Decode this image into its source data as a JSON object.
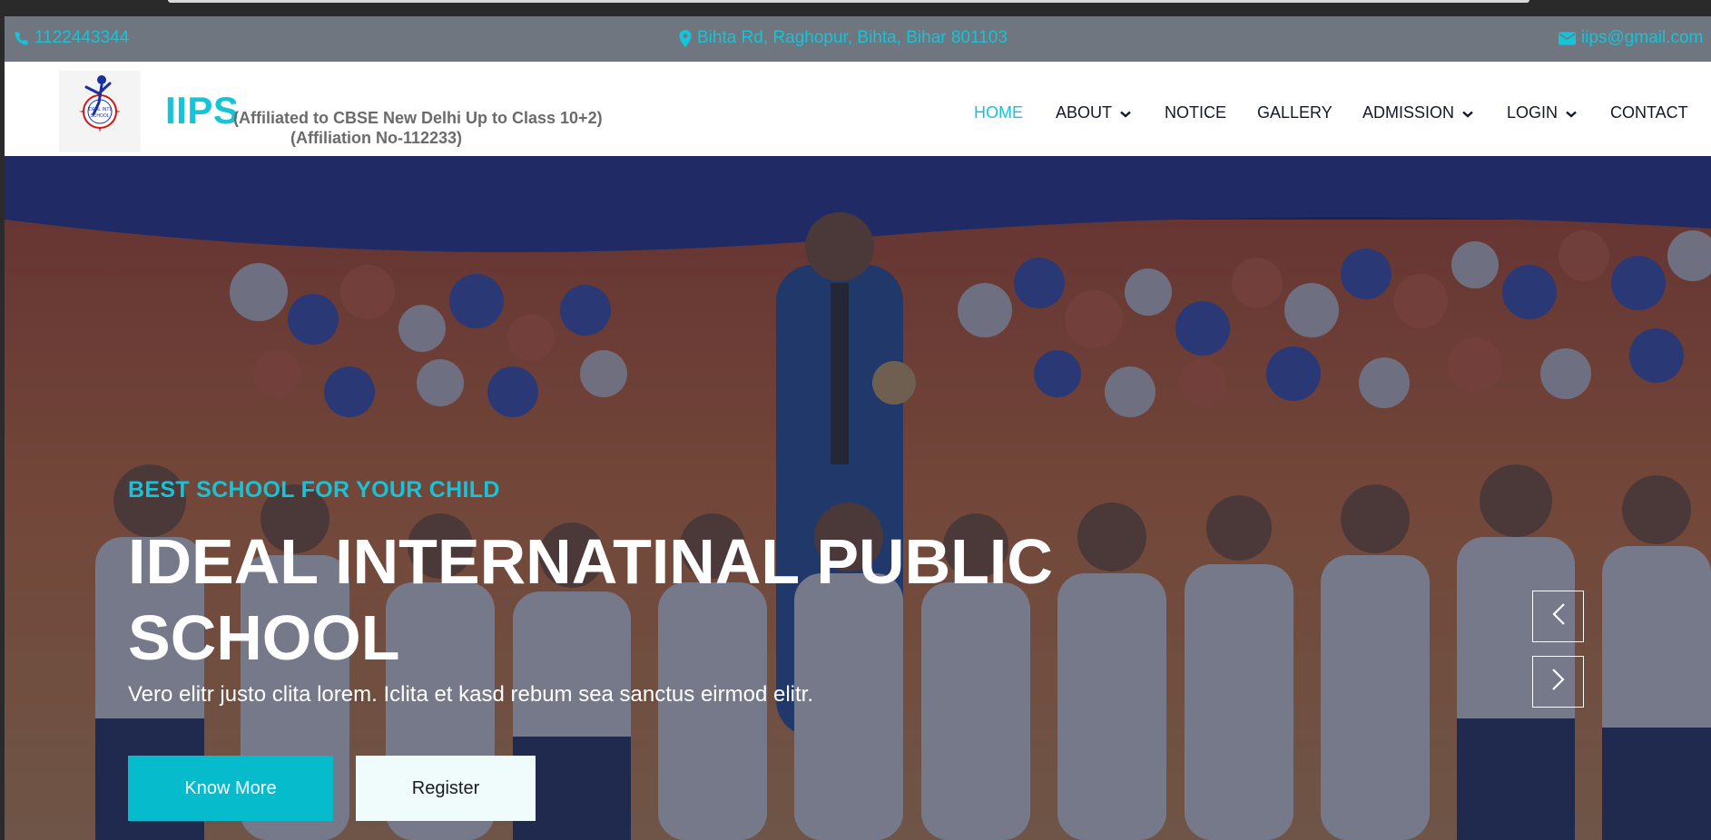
{
  "topbar": {
    "phone": "1122443344",
    "address": "Bihta Rd, Raghopur, Bihta, Bihar 801103",
    "email": "iips@gmail.com"
  },
  "header": {
    "brand": "IIPS",
    "affiliation": "(Affiliated to CBSE New Delhi Up to Class 10+2)",
    "affiliation_no": "(Affiliation No-112233)",
    "logo_text": "IDEAL INTERNATIONAL SCHOOL"
  },
  "nav": {
    "items": [
      {
        "label": "HOME",
        "active": true
      },
      {
        "label": "ABOUT",
        "dropdown": true
      },
      {
        "label": "NOTICE"
      },
      {
        "label": "GALLERY"
      },
      {
        "label": "ADMISSION",
        "dropdown": true
      },
      {
        "label": "LOGIN",
        "dropdown": true
      },
      {
        "label": "CONTACT"
      }
    ]
  },
  "hero": {
    "kicker": "BEST SCHOOL FOR YOUR CHILD",
    "title": "IDEAL INTERNATINAL PUBLIC SCHOOL",
    "subtitle": "Vero elitr justo clita lorem. Iclita et kasd rebum sea sanctus eirmod elitr.",
    "primary_button": "Know More",
    "secondary_button": "Register"
  },
  "colors": {
    "accent": "#17c3d6",
    "topbar_bg": "#6f7680",
    "primary_button_bg": "#06bbcc",
    "nav_text": "#12192b"
  },
  "icons": {
    "phone": "phone-icon",
    "address": "map-marker-icon",
    "email": "envelope-icon",
    "prev": "chevron-left-icon",
    "next": "chevron-right-icon",
    "dropdown": "chevron-down-icon"
  }
}
